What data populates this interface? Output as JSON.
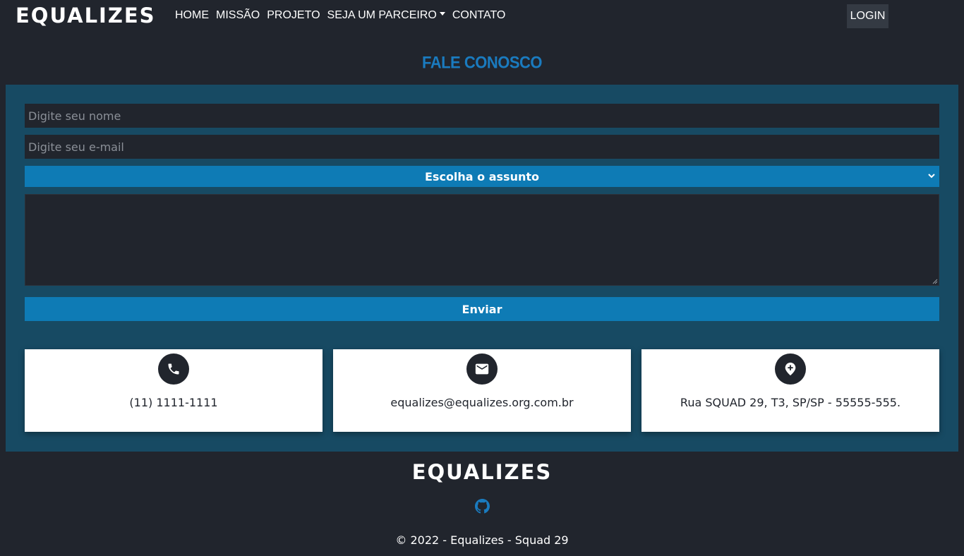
{
  "navbar": {
    "logo": "EQUALIZES",
    "links": [
      {
        "label": "HOME"
      },
      {
        "label": "MISSÃO"
      },
      {
        "label": "PROJETO"
      },
      {
        "label": "SEJA UM PARCEIRO"
      },
      {
        "label": "CONTATO"
      }
    ],
    "login_label": "LOGIN"
  },
  "contact": {
    "title": "FALE CONOSCO",
    "name_placeholder": "Digite seu nome",
    "email_placeholder": "Digite seu e-mail",
    "subject_selected": "Escolha o assunto",
    "submit_label": "Enviar"
  },
  "cards": [
    {
      "icon": "phone-icon",
      "text": "(11) 1111-1111"
    },
    {
      "icon": "mail-icon",
      "text": "equalizes@equalizes.org.com.br"
    },
    {
      "icon": "location-pin-icon",
      "text": "Rua SQUAD 29, T3, SP/SP - 55555-555."
    }
  ],
  "footer": {
    "logo": "EQUALIZES",
    "github_icon": "github-icon",
    "copyright": "© 2022 - Equalizes - Squad 29"
  },
  "colors": {
    "background": "#21252d",
    "panel": "#174a63",
    "accent": "#0e7bb5",
    "title": "#1a7bbf"
  }
}
